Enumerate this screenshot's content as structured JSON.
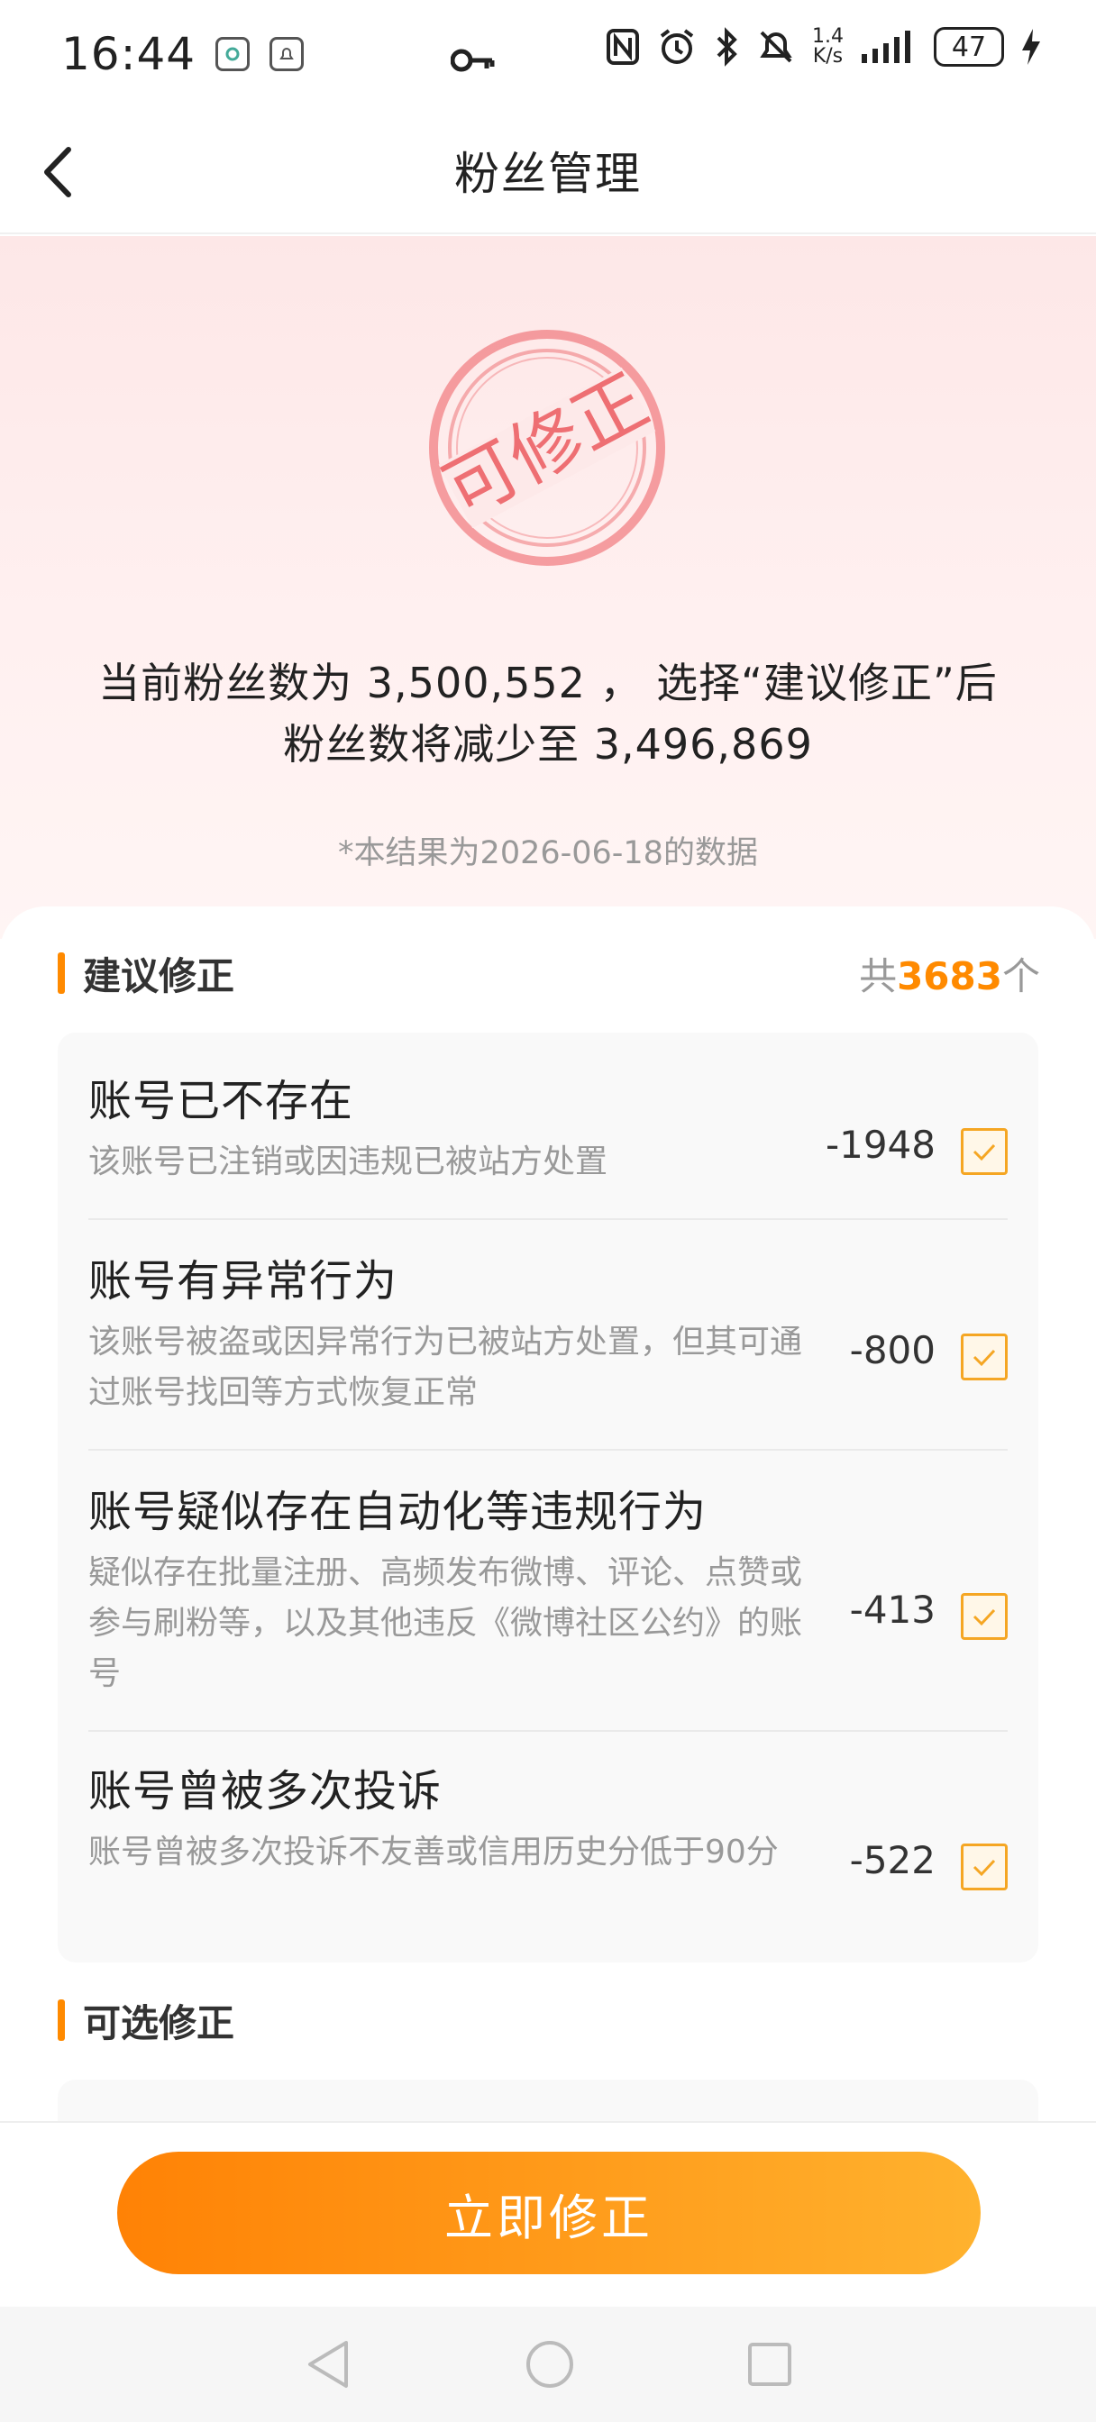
{
  "status_bar": {
    "time": "16:44",
    "speed_value": "1.4",
    "speed_unit": "K/s",
    "battery": "47"
  },
  "header": {
    "title": "粉丝管理"
  },
  "hero": {
    "stamp_text": "可修正",
    "line1": "当前粉丝数为 3,500,552 ， 选择“建议修正”后",
    "line2": "粉丝数将减少至 3,496,869",
    "note": "*本结果为2026-06-18的数据"
  },
  "suggested": {
    "title": "建议修正",
    "total_prefix": "共",
    "total_count": "3683",
    "total_suffix": "个",
    "items": [
      {
        "title": "账号已不存在",
        "desc": "该账号已注销或因违规已被站方处置",
        "value": "-1948",
        "checked": true
      },
      {
        "title": "账号有异常行为",
        "desc": "该账号被盗或因异常行为已被站方处置，但其可通过账号找回等方式恢复正常",
        "value": "-800",
        "checked": true
      },
      {
        "title": "账号疑似存在自动化等违规行为",
        "desc": "疑似存在批量注册、高频发布微博、评论、点赞或参与刷粉等，以及其他违反《微博社区公约》的账号",
        "value": "-413",
        "checked": true
      },
      {
        "title": "账号曾被多次投诉",
        "desc": "账号曾被多次投诉不友善或信用历史分低于90分",
        "value": "-522",
        "checked": true
      }
    ]
  },
  "optional": {
    "title": "可选修正"
  },
  "action": {
    "button_label": "立即修正"
  },
  "colors": {
    "accent": "#ff8a00",
    "button_start": "#ff8205",
    "button_end": "#ffb22e",
    "stamp": "#ec5a5f",
    "checkbox": "#f5a623"
  },
  "icons": {
    "back": "chevron-left-icon",
    "key": "key-icon",
    "check": "check-icon",
    "nav_back": "triangle-back-icon",
    "nav_home": "circle-home-icon",
    "nav_recent": "square-recent-icon"
  }
}
